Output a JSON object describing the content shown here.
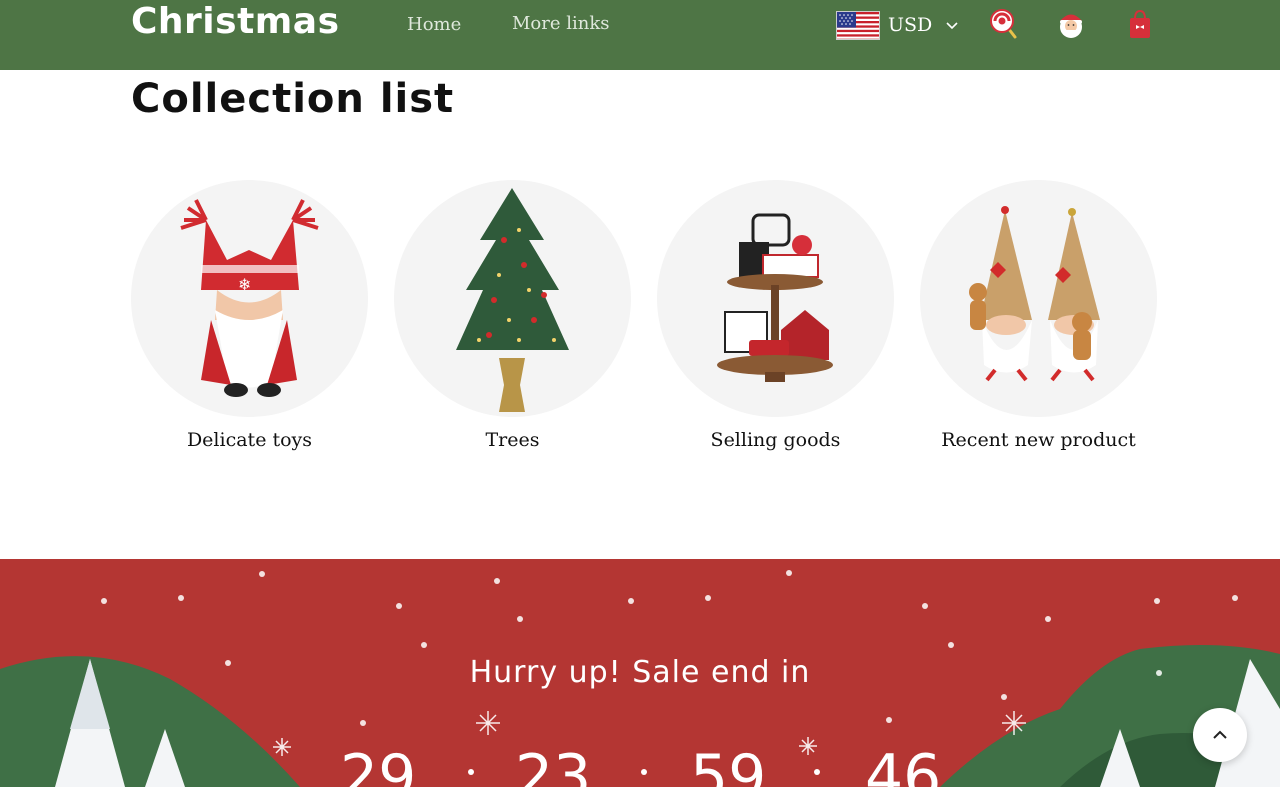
{
  "header": {
    "logo": "Christmas",
    "nav": {
      "home": "Home",
      "more_links": "More links"
    },
    "currency": {
      "code": "USD",
      "flag_icon": "us-flag-icon"
    },
    "icons": [
      "lollipop-search-icon",
      "santa-account-icon",
      "gift-bag-cart-icon"
    ],
    "background": "#4e7545"
  },
  "collection": {
    "title": "Collection list",
    "items": [
      {
        "label": "Delicate toys",
        "image": "red-gnome"
      },
      {
        "label": "Trees",
        "image": "christmas-tree"
      },
      {
        "label": "Selling goods",
        "image": "tiered-tray"
      },
      {
        "label": "Recent new product",
        "image": "gingerbread-gnomes"
      }
    ]
  },
  "sale": {
    "title": "Hurry up! Sale end in",
    "countdown": [
      "29",
      "23",
      "59",
      "46"
    ],
    "background": "#b43633"
  }
}
